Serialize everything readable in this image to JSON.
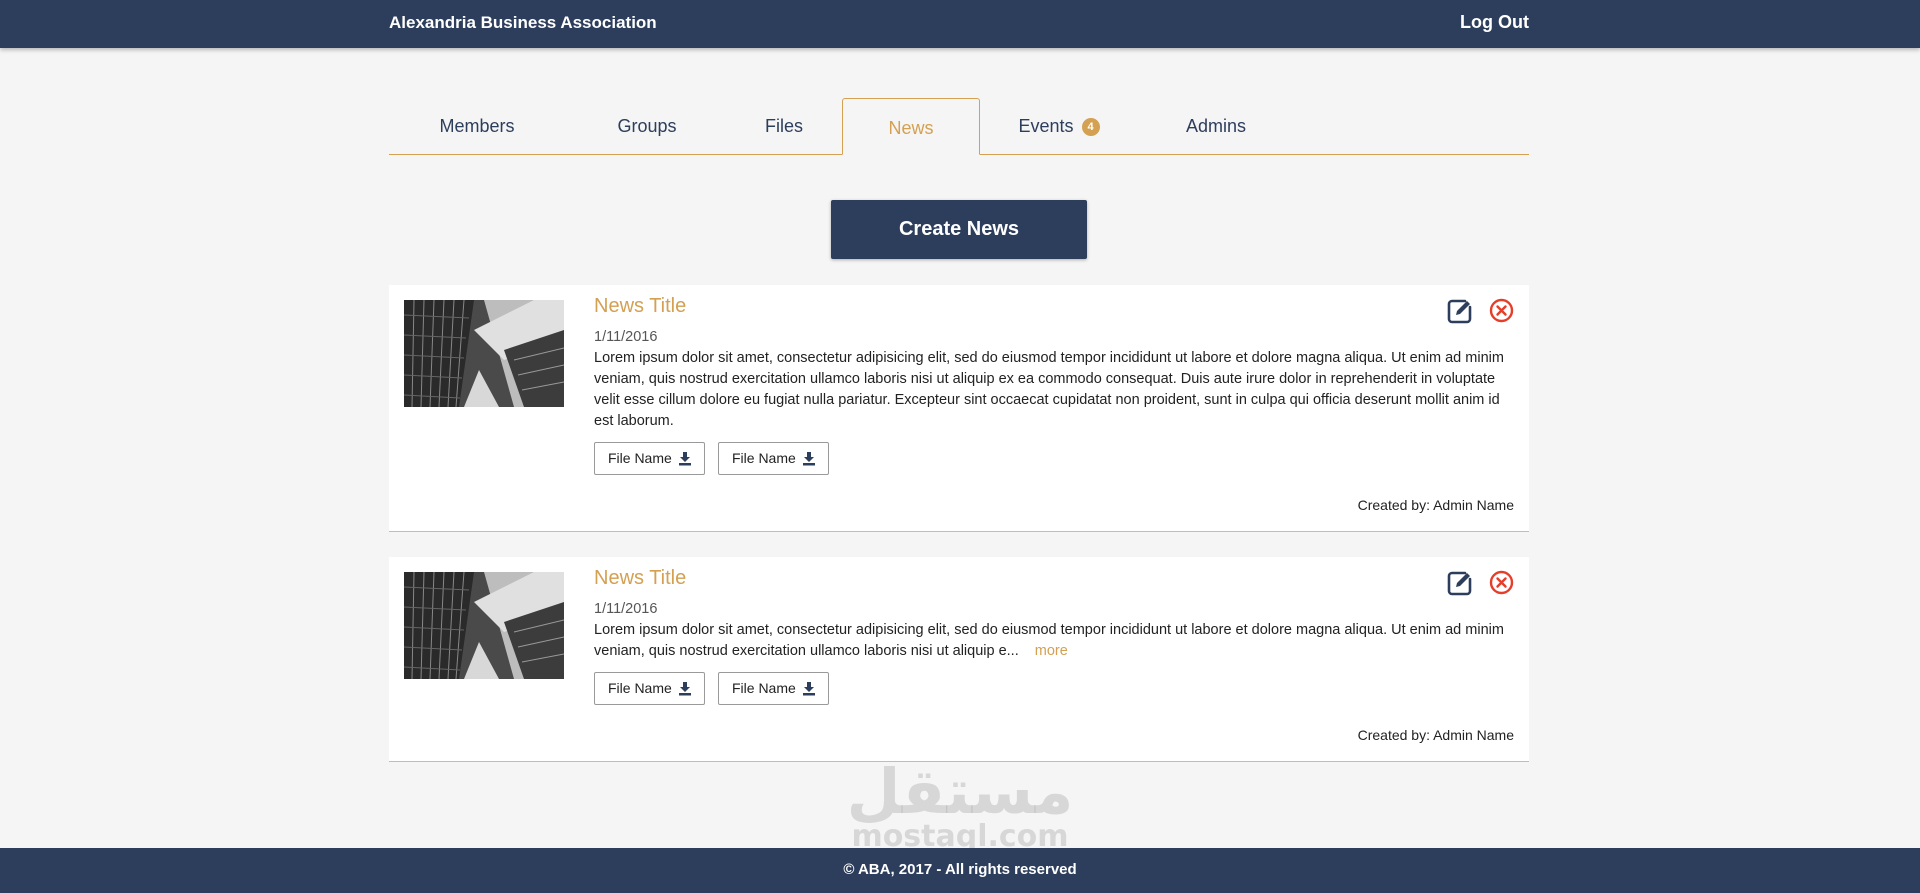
{
  "header": {
    "brand": "Alexandria Business Association",
    "logout_label": "Log Out"
  },
  "tabs": [
    {
      "label": "Members",
      "active": false
    },
    {
      "label": "Groups",
      "active": false
    },
    {
      "label": "Files",
      "active": false
    },
    {
      "label": "News",
      "active": true
    },
    {
      "label": "Events",
      "active": false,
      "badge": "4"
    },
    {
      "label": "Admins",
      "active": false
    }
  ],
  "actions": {
    "create_label": "Create News"
  },
  "news": [
    {
      "title": "News Title",
      "date": "1/11/2016",
      "body": "Lorem ipsum dolor sit amet, consectetur adipisicing elit, sed do eiusmod tempor incididunt ut labore et dolore magna aliqua. Ut enim ad minim veniam, quis nostrud exercitation ullamco laboris nisi ut aliquip ex ea commodo consequat. Duis aute irure dolor in reprehenderit in voluptate velit esse cillum dolore eu fugiat nulla pariatur. Excepteur sint occaecat cupidatat non proident, sunt in culpa qui officia deserunt mollit anim id est laborum.",
      "files": [
        "File Name",
        "File Name"
      ],
      "created_by": "Created by: Admin Name"
    },
    {
      "title": "News Title",
      "date": "1/11/2016",
      "body": "Lorem ipsum dolor sit amet, consectetur adipisicing elit, sed do eiusmod tempor incididunt ut labore et dolore magna aliqua. Ut enim ad minim veniam, quis nostrud exercitation ullamco laboris nisi ut aliquip e...",
      "more_label": "more",
      "files": [
        "File Name",
        "File Name"
      ],
      "created_by": "Created by: Admin Name"
    }
  ],
  "watermark": {
    "arabic": "مستقل",
    "latin": "mostaql.com"
  },
  "footer": {
    "copyright": "© ABA, 2017 - All rights reserved"
  },
  "colors": {
    "primary": "#2d3e5c",
    "accent": "#d4a052",
    "danger": "#e53e2b",
    "background": "#f5f5f5"
  }
}
